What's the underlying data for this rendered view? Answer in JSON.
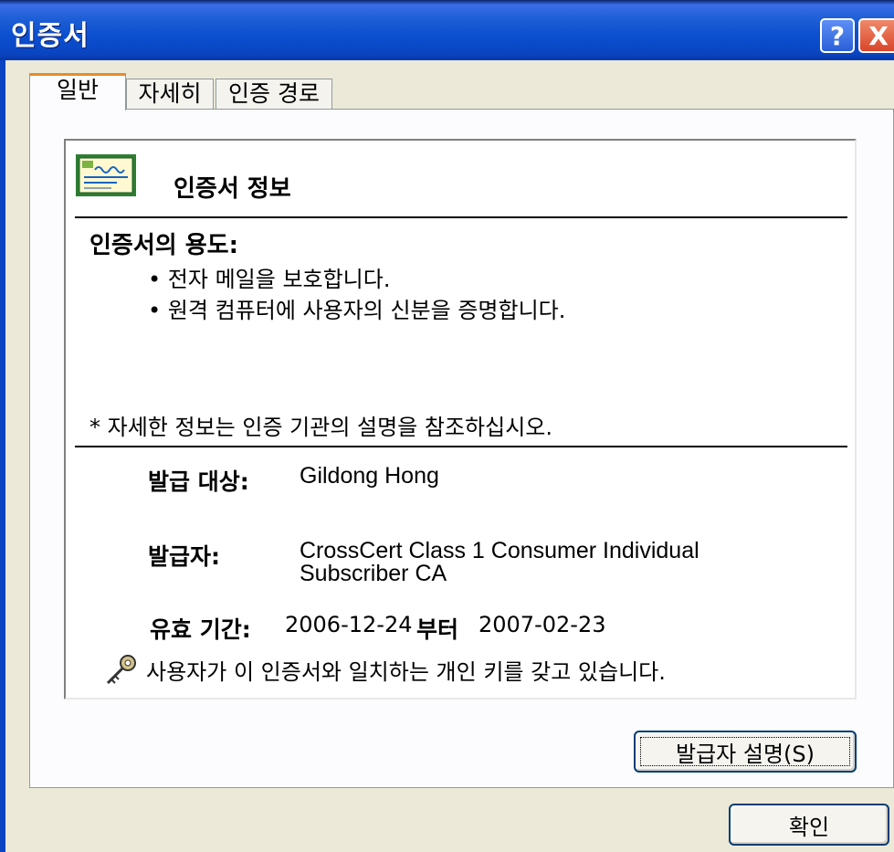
{
  "window": {
    "title": "인증서"
  },
  "title_buttons": {
    "help": "?",
    "close": "X"
  },
  "tabs": [
    {
      "label": "일반",
      "active": true
    },
    {
      "label": "자세히",
      "active": false
    },
    {
      "label": "인증 경로",
      "active": false
    }
  ],
  "cert_info": {
    "heading": "인증서 정보",
    "purposes_label": "인증서의 용도:",
    "purposes": [
      "• 전자 메일을 보호합니다.",
      "• 원격 컴퓨터에 사용자의 신분을 증명합니다."
    ],
    "note": "* 자세한 정보는 인증 기관의 설명을 참조하십시오.",
    "issued_to_label": "발급 대상:",
    "issued_to": "Gildong Hong",
    "issuer_label": "발급자:",
    "issuer_line1": "CrossCert Class 1 Consumer Individual",
    "issuer_line2": "Subscriber CA",
    "validity_label": "유효 기간:",
    "valid_from": "2006-12-24",
    "validity_from_word": "부터",
    "valid_to": "2007-02-23",
    "private_key_note": "사용자가 이 인증서와 일치하는 개인 키를 갖고 있습니다."
  },
  "buttons": {
    "issuer_statement": "발급자 설명(S)",
    "ok": "확인"
  },
  "icons": {
    "certificate": "certificate-icon",
    "key": "key-icon"
  },
  "colors": {
    "titlebar": "#0a44c0",
    "tab_accent": "#e68b2c",
    "button_border": "#003c74"
  }
}
